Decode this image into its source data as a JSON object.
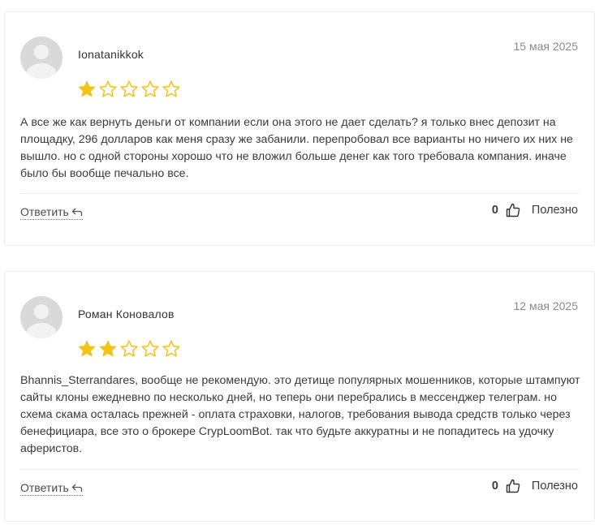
{
  "colors": {
    "star_filled": "#f2c318",
    "star_outline": "#f2c318",
    "avatar_bg": "#d9d9d9"
  },
  "reviews": [
    {
      "author": "Ionatanikkok",
      "date": "15 мая 2025",
      "rating": 1,
      "max_rating": 5,
      "text": "А все же как вернуть деньги от компании если она этого не дает сделать? я только внес депозит на площадку, 296 долларов как меня сразу же забанили. перепробовал все варианты но ничего их них не вышло. но с одной стороны хорошо что не вложил больше денег как того требовала компания. иначе было бы вообще печально все.",
      "reply_label": "Ответить",
      "votes": "0",
      "useful_label": "Полезно"
    },
    {
      "author": "Роман Коновалов",
      "date": "12 мая 2025",
      "rating": 2,
      "max_rating": 5,
      "text": "Bhannis_Sterrandares, вообще не рекомендую. это детище популярных мошенников, которые штампуют сайты клоны ежедневно по несколько дней, но теперь они перебрались в мессенджер телеграм. но схема скама осталась прежней - оплата страховки, налогов, требования вывода средств только через бенефициара, все это о брокере CrypLoomBot. так что будьте аккуратны и не попадитесь на удочку аферистов.",
      "reply_label": "Ответить",
      "votes": "0",
      "useful_label": "Полезно"
    }
  ]
}
